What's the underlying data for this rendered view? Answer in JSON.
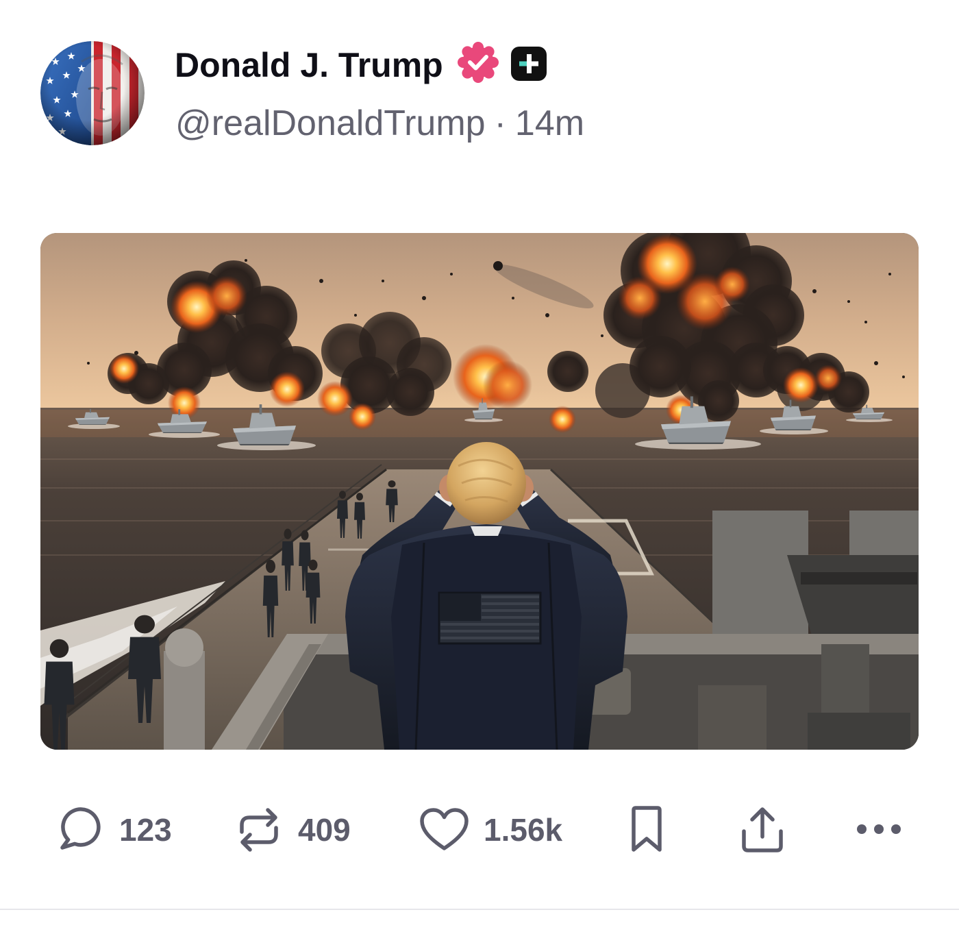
{
  "post": {
    "author": {
      "display_name": "Donald J. Trump",
      "handle": "@realDonaldTrump",
      "avatar_icon": "avatar",
      "verified_icon": "verified-badge-icon",
      "subscription_icon": "plus-badge-icon"
    },
    "separator": "·",
    "timestamp": "14m",
    "media_icon": "post-image"
  },
  "actions": {
    "reply": {
      "icon": "reply-icon",
      "count": "123"
    },
    "repost": {
      "icon": "repost-icon",
      "count": "409"
    },
    "like": {
      "icon": "heart-icon",
      "count": "1.56k"
    },
    "bookmark": {
      "icon": "bookmark-icon"
    },
    "share": {
      "icon": "share-icon"
    },
    "more": {
      "icon": "more-icon"
    }
  },
  "colors": {
    "name_text": "#0f0f17",
    "meta_text": "#62626f",
    "action_icon": "#5c5c6b",
    "verified_badge": "#e9487b",
    "plus_badge": "#111111",
    "plus_accent": "#4fd1bf",
    "divider": "#e6e6ea"
  }
}
